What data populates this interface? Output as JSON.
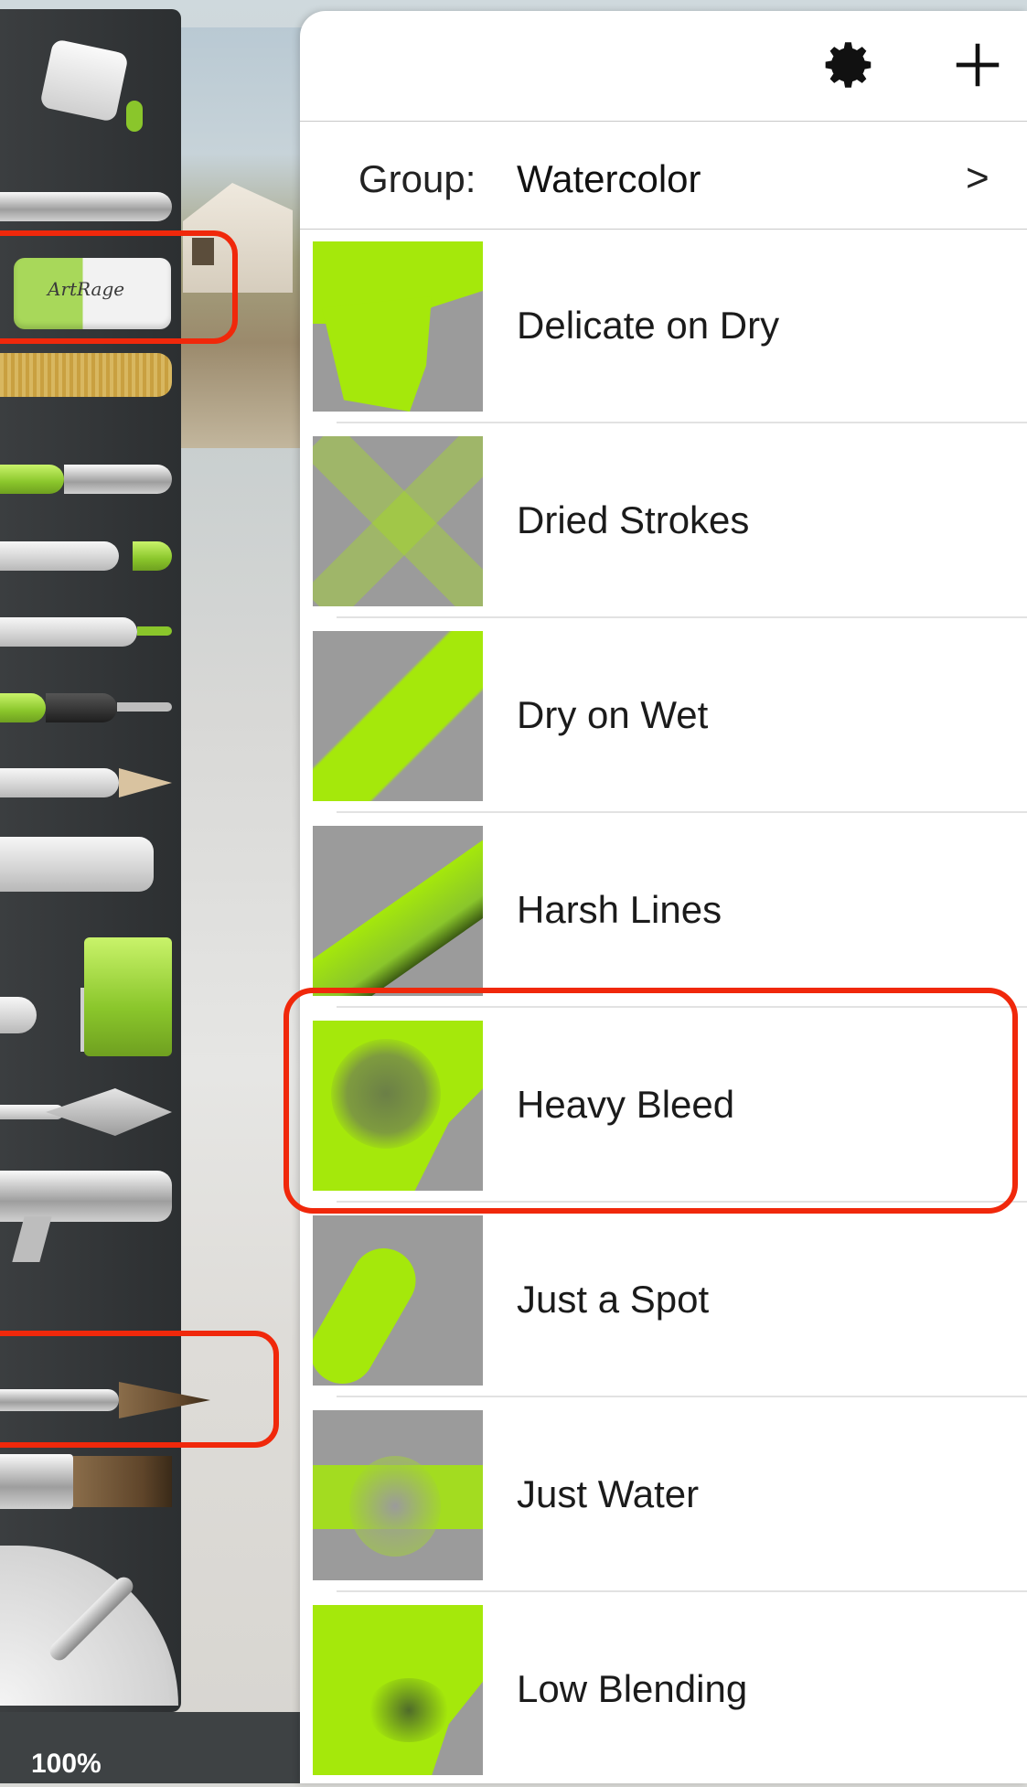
{
  "zoom": {
    "label": "100%"
  },
  "tools": {
    "eraser_logo": "ArtRage"
  },
  "presets_panel": {
    "group_label": "Group:",
    "group_value": "Watercolor",
    "group_chevron": ">",
    "presets": [
      {
        "label": "Delicate on Dry"
      },
      {
        "label": "Dried Strokes"
      },
      {
        "label": "Dry on Wet"
      },
      {
        "label": "Harsh Lines"
      },
      {
        "label": "Heavy Bleed",
        "highlighted": true
      },
      {
        "label": "Just a Spot"
      },
      {
        "label": "Just Water"
      },
      {
        "label": "Low Blending"
      }
    ]
  },
  "colors": {
    "accent_green": "#a5e80b",
    "highlight_red": "#f0280b",
    "thumb_gray": "#9b9b9b"
  },
  "icons": [
    "gear-icon",
    "plus-icon",
    "chevron-right-icon"
  ]
}
